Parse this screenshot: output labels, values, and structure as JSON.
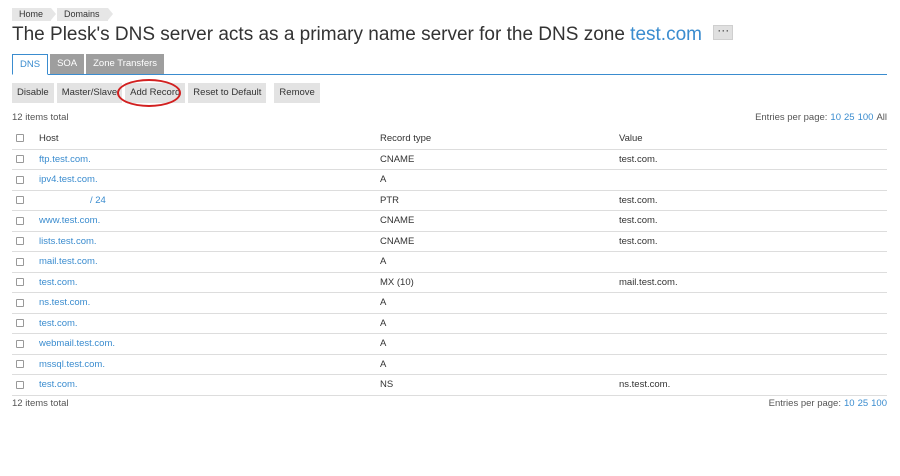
{
  "breadcrumb": [
    "Home",
    "Domains"
  ],
  "page_title": "The Plesk's DNS server acts as a primary name server for the DNS zone",
  "zone_name": "test.com",
  "more_label": "···",
  "tabs": [
    "DNS",
    "SOA",
    "Zone Transfers"
  ],
  "toolbar": [
    "Disable",
    "Master/Slave",
    "Add Record",
    "Reset to Default",
    "Remove"
  ],
  "items_total": "12 items total",
  "entries_label": "Entries per page:",
  "entries_options": [
    "10",
    "25",
    "100",
    "All"
  ],
  "columns": [
    "Host",
    "Record type",
    "Value"
  ],
  "rows": [
    {
      "host": "ftp.test.com.",
      "type": "CNAME",
      "value": "test.com."
    },
    {
      "host": "ipv4.test.com.",
      "type": "A",
      "value": ""
    },
    {
      "host": "/ 24",
      "type": "PTR",
      "value": "test.com."
    },
    {
      "host": "www.test.com.",
      "type": "CNAME",
      "value": "test.com."
    },
    {
      "host": "lists.test.com.",
      "type": "CNAME",
      "value": "test.com."
    },
    {
      "host": "mail.test.com.",
      "type": "A",
      "value": ""
    },
    {
      "host": "test.com.",
      "type": "MX (10)",
      "value": "mail.test.com."
    },
    {
      "host": "ns.test.com.",
      "type": "A",
      "value": ""
    },
    {
      "host": "test.com.",
      "type": "A",
      "value": ""
    },
    {
      "host": "webmail.test.com.",
      "type": "A",
      "value": ""
    },
    {
      "host": "mssql.test.com.",
      "type": "A",
      "value": ""
    },
    {
      "host": "test.com.",
      "type": "NS",
      "value": "ns.test.com."
    }
  ],
  "colors": {
    "link": "#3a8ccf",
    "annotation": "#d21f1f",
    "tab_inactive": "#9e9e9e"
  }
}
